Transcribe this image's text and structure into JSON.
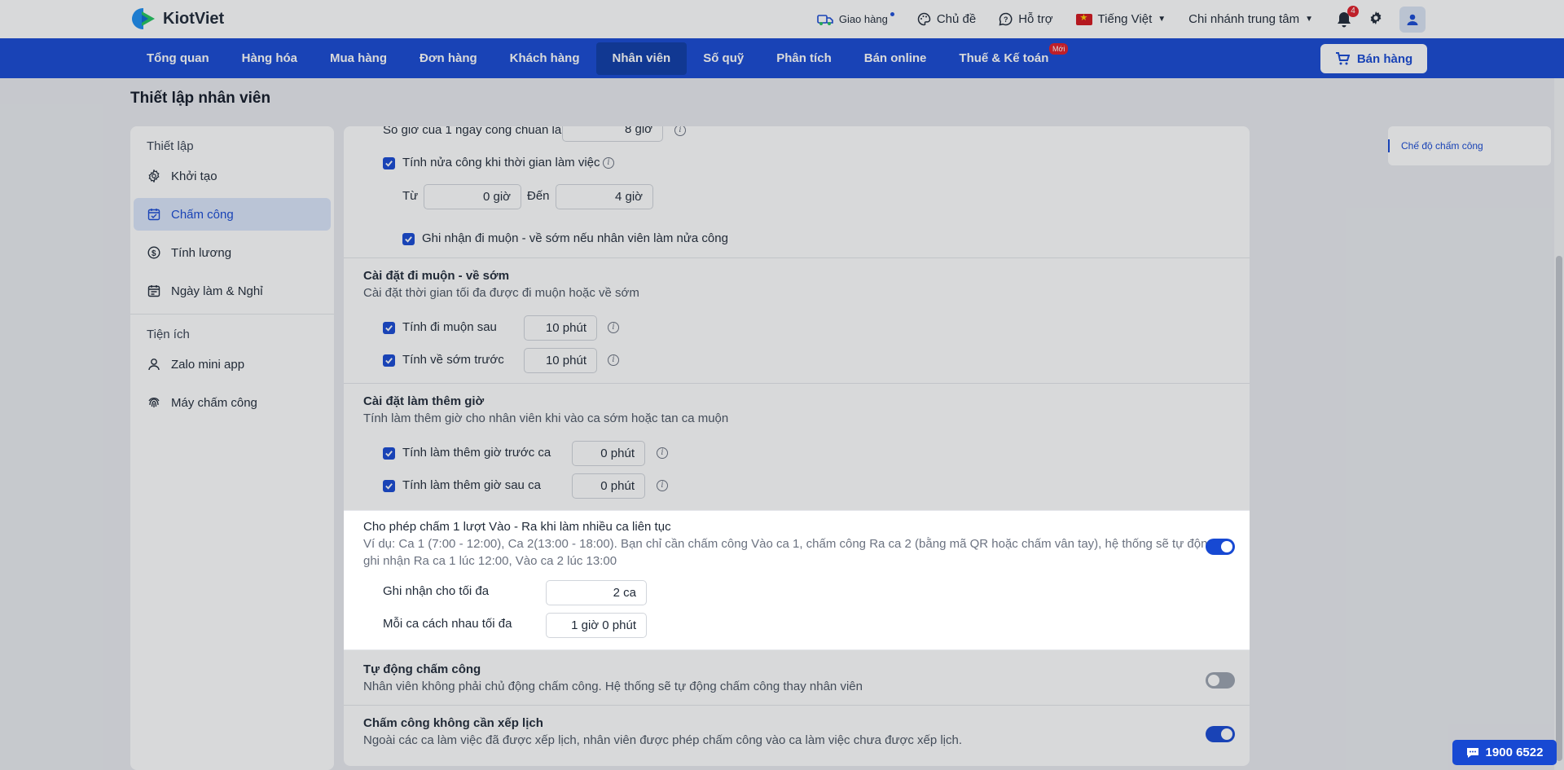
{
  "app": {
    "name": "KiotViet"
  },
  "topbar": {
    "delivery": "Giao hàng",
    "theme": "Chủ đề",
    "support": "Hỗ trợ",
    "language": "Tiếng Việt",
    "branch": "Chi nhánh trung tâm",
    "notification_count": "4"
  },
  "nav": {
    "items": [
      "Tổng quan",
      "Hàng hóa",
      "Mua hàng",
      "Đơn hàng",
      "Khách hàng",
      "Nhân viên",
      "Số quỹ",
      "Phân tích",
      "Bán online",
      "Thuế & Kế toán"
    ],
    "active": "Nhân viên",
    "new_badge": "Mới",
    "sell_button": "Bán hàng"
  },
  "page": {
    "title": "Thiết lập nhân viên"
  },
  "sidebar": {
    "section1": "Thiết lập",
    "items1": [
      "Khởi tạo",
      "Chấm công",
      "Tính lương",
      "Ngày làm & Nghỉ"
    ],
    "active": "Chấm công",
    "section2": "Tiện ích",
    "items2": [
      "Zalo mini app",
      "Máy chấm công"
    ]
  },
  "main": {
    "standard_hours_label": "Số giờ của 1 ngày công chuẩn là",
    "standard_hours_value": "8 giờ",
    "half_day_label": "Tính nửa công khi thời gian làm việc",
    "from_label": "Từ",
    "from_value": "0 giờ",
    "to_label": "Đến",
    "to_value": "4 giờ",
    "half_day_late_label": "Ghi nhận đi muộn - về sớm nếu nhân viên làm nửa công",
    "late_title": "Cài đặt đi muộn - về sớm",
    "late_desc": "Cài đặt thời gian tối đa được đi muộn hoặc về sớm",
    "late_after_label": "Tính đi muộn sau",
    "late_after_value": "10 phút",
    "early_before_label": "Tính về sớm trước",
    "early_before_value": "10 phút",
    "overtime_title": "Cài đặt làm thêm giờ",
    "overtime_desc": "Tính làm thêm giờ cho nhân viên khi vào ca sớm hoặc tan ca muộn",
    "ot_before_label": "Tính làm thêm giờ trước ca",
    "ot_before_value": "0 phút",
    "ot_after_label": "Tính làm thêm giờ sau ca",
    "ot_after_value": "0 phút",
    "multi_shift_title": "Cho phép chấm 1 lượt Vào - Ra khi làm nhiều ca liên tục",
    "multi_shift_desc1": "Ví dụ: Ca 1 (7:00 - 12:00), Ca 2(13:00 - 18:00). Bạn chỉ cần chấm công Vào ca 1, chấm công Ra ca 2 (bằng mã QR hoặc chấm vân tay), hệ thống sẽ tự động",
    "multi_shift_desc2": "ghi nhận Ra ca 1 lúc 12:00, Vào ca 2 lúc 13:00",
    "max_shifts_label": "Ghi nhận cho tối đa",
    "max_shifts_value": "2 ca",
    "max_gap_label": "Mỗi ca cách nhau tối đa",
    "max_gap_value": "1 giờ 0 phút",
    "auto_title": "Tự động chấm công",
    "auto_desc": "Nhân viên không phải chủ động chấm công. Hệ thống sẽ tự động chấm công thay nhân viên",
    "noschedule_title": "Chấm công không cần xếp lịch",
    "noschedule_desc": "Ngoài các ca làm việc đã được xếp lịch, nhân viên được phép chấm công vào ca làm việc chưa được xếp lịch."
  },
  "toggles": {
    "multi_shift": true,
    "auto": false,
    "noschedule": true
  },
  "rightpanel": {
    "link": "Chế độ chấm công"
  },
  "hotline": "1900 6522",
  "colors": {
    "brand": "#1749d3",
    "badge": "#e11d28"
  }
}
